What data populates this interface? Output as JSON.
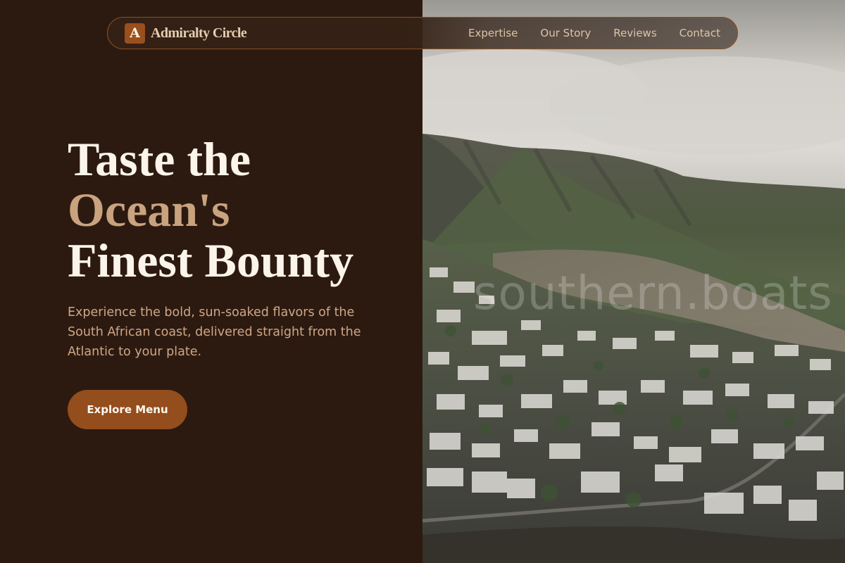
{
  "brand": {
    "badge": "A",
    "name": "Admiralty Circle"
  },
  "nav": {
    "items": [
      {
        "label": "Expertise"
      },
      {
        "label": "Our Story"
      },
      {
        "label": "Reviews"
      },
      {
        "label": "Contact"
      }
    ]
  },
  "hero": {
    "line1": "Taste the",
    "line2": "Ocean's",
    "line3": "Finest Bounty",
    "description": "Experience the bold, sun-soaked flavors of the South African coast, delivered straight from the Atlantic to your plate.",
    "cta_label": "Explore Menu"
  },
  "photo": {
    "watermark": "southern.boats"
  },
  "colors": {
    "background": "#2c1a10",
    "accent": "#944d1c",
    "headline_accent": "#c9a37f",
    "body_text": "#cfa787"
  }
}
